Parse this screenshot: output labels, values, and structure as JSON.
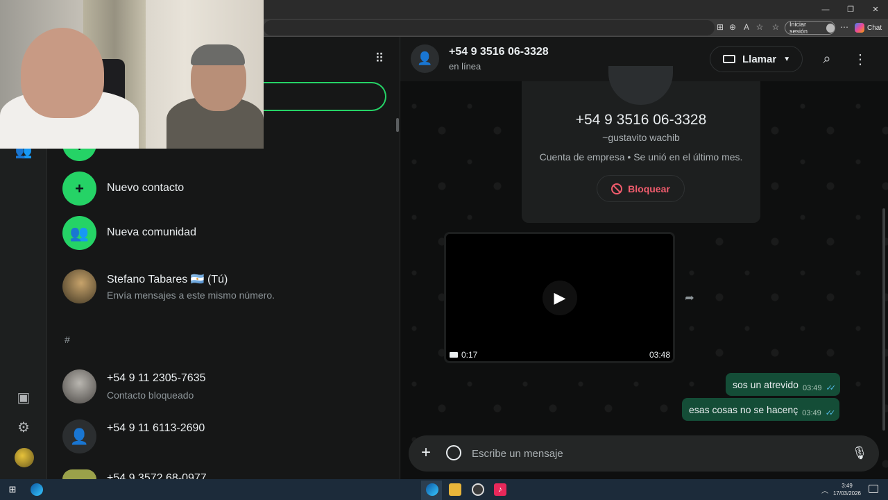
{
  "browser": {
    "signin_label": "Iniciar sesión",
    "chat_label": "Chat"
  },
  "contacts_panel": {
    "items": [
      {
        "title": "Nuevo contacto"
      },
      {
        "title": "Nueva comunidad"
      },
      {
        "title": "Stefano Tabares 🇦🇷 (Tú)",
        "subtitle": "Envía mensajes a este mismo número."
      }
    ],
    "section_header": "#",
    "contacts": [
      {
        "title": "+54 9 11 2305-7635",
        "subtitle": "Contacto bloqueado"
      },
      {
        "title": "+54 9 11 6113-2690"
      },
      {
        "title": "+54 9 3572 68-0977"
      }
    ]
  },
  "chat": {
    "header": {
      "name": "+54 9 3516 06-3328",
      "status": "en línea",
      "call_label": "Llamar"
    },
    "info_card": {
      "phone": "+54 9 3516 06-3328",
      "nickname": "~gustavito wachib",
      "business_line": "Cuenta de empresa • Se unió en el último mes.",
      "block_label": "Bloquear"
    },
    "video": {
      "duration": "0:17",
      "time": "03:48"
    },
    "messages": [
      {
        "text": "sos un atrevido",
        "time": "03:49"
      },
      {
        "text": "esas cosas no se hacenç",
        "time": "03:49"
      }
    ],
    "composer": {
      "placeholder": "Escribe un mensaje"
    }
  },
  "taskbar": {
    "time": "3:49",
    "date": "17/03/2026"
  },
  "colors": {
    "accent": "#25d366",
    "bubble_out": "#144d37",
    "danger": "#f15c6d",
    "read_ticks": "#53bdeb"
  }
}
